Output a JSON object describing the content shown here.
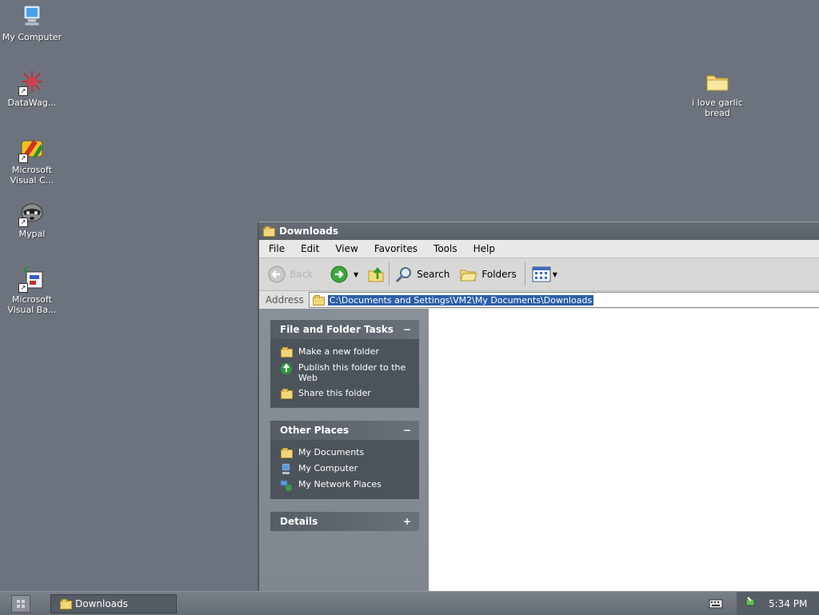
{
  "desktop": {
    "icons": [
      {
        "label": "My Computer"
      },
      {
        "label": "DataWag..."
      },
      {
        "label": "Microsoft Visual C..."
      },
      {
        "label": "Mypal"
      },
      {
        "label": "Microsoft Visual Ba..."
      },
      {
        "label": "i love garlic bread"
      }
    ]
  },
  "window": {
    "title": "Downloads",
    "menu": [
      "File",
      "Edit",
      "View",
      "Favorites",
      "Tools",
      "Help"
    ],
    "toolbar": {
      "back_label": "Back",
      "search_label": "Search",
      "folders_label": "Folders"
    },
    "address": {
      "label": "Address",
      "value": "C:\\Documents and Settings\\VM2\\My Documents\\Downloads"
    },
    "taskpane": {
      "file_tasks": {
        "title": "File and Folder Tasks",
        "toggle": "−",
        "items": [
          "Make a new folder",
          "Publish this folder to the Web",
          "Share this folder"
        ]
      },
      "other_places": {
        "title": "Other Places",
        "toggle": "−",
        "items": [
          "My Documents",
          "My Computer",
          "My Network Places"
        ]
      },
      "details": {
        "title": "Details",
        "toggle": "+"
      }
    }
  },
  "taskbar": {
    "task_label": "Downloads",
    "clock": "5:34 PM"
  },
  "colors": {
    "desktop": "#6d737c",
    "selection": "#2c5fa8",
    "panel_body": "#4c535a"
  }
}
